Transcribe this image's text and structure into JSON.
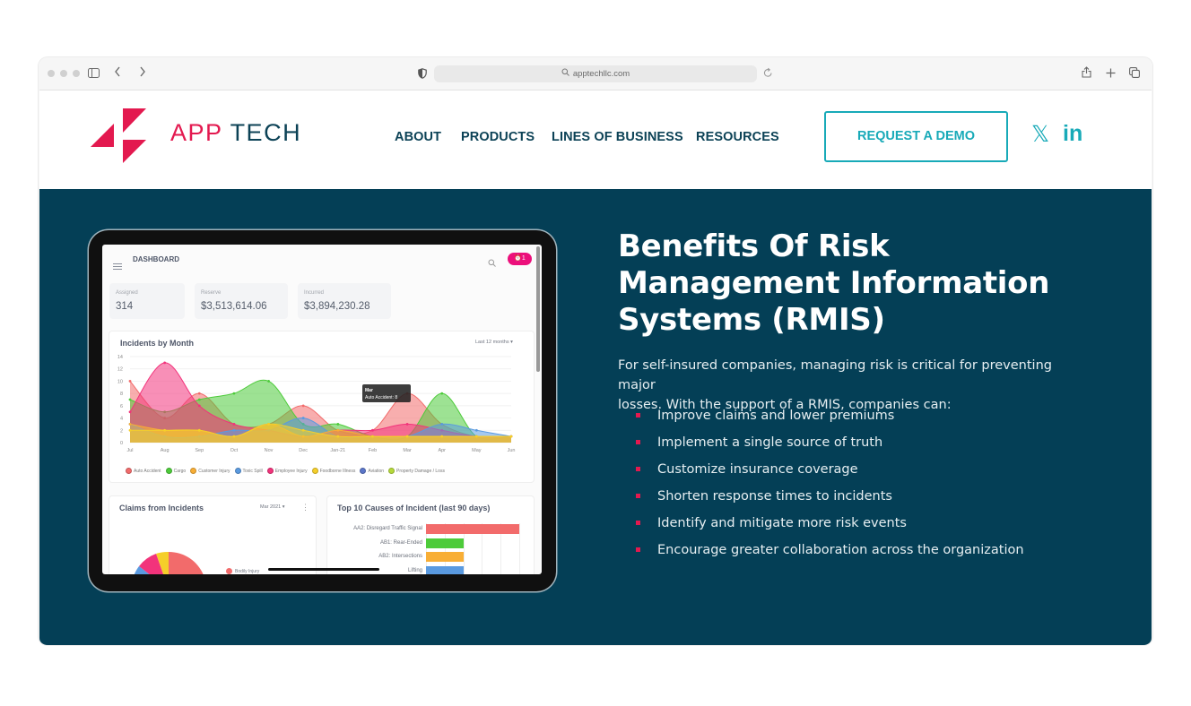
{
  "browser": {
    "url": "apptechllc.com",
    "icons": {
      "sidebar": "sidebar-icon",
      "back": "chevron-left-icon",
      "forward": "chevron-right-icon",
      "shield": "privacy-shield-icon",
      "reload": "reload-icon",
      "share": "share-icon",
      "new_tab": "plus-icon",
      "tabs": "tab-overview-icon"
    }
  },
  "header": {
    "brand_part1": "APP",
    "brand_part2": "TECH",
    "nav": [
      "ABOUT",
      "PRODUCTS",
      "LINES OF BUSINESS",
      "RESOURCES"
    ],
    "cta": "REQUEST A DEMO",
    "social": {
      "x": "𝕏",
      "linkedin": "in"
    },
    "colors": {
      "brand_red": "#e3194f",
      "brand_navy": "#0c4256",
      "accent_teal": "#18aab8"
    }
  },
  "hero": {
    "background": "#043f56",
    "heading_lines": [
      "Benefits Of Risk",
      "Management Information",
      "Systems (RMIS)"
    ],
    "intro_lines": [
      "For self-insured companies, managing risk is critical for preventing major",
      "losses. With the support of a RMIS, companies can:"
    ],
    "benefits": [
      "Improve claims and lower premiums",
      "Implement a single source of truth",
      "Customize insurance coverage",
      "Shorten response times to incidents",
      "Identify and mitigate more risk events",
      "Encourage greater collaboration across the organization"
    ]
  },
  "dashboard": {
    "title": "DASHBOARD",
    "notification_count": "1",
    "stats": [
      {
        "label": "Assigned",
        "value": "314"
      },
      {
        "label": "Reserve",
        "value": "$3,513,614.06"
      },
      {
        "label": "Incurred",
        "value": "$3,894,230.28"
      }
    ],
    "incidents_card": {
      "title": "Incidents by Month",
      "range_selector": "Last 12 months",
      "tooltip": {
        "title": "Mar",
        "text": "Auto Accident: 8"
      }
    },
    "claims_card": {
      "title": "Claims from Incidents",
      "period_selector": "Mar 2021",
      "legend_first": "Bodily Injury"
    },
    "causes_card": {
      "title": "Top 10 Causes of Incident (last 90 days)",
      "bars": [
        {
          "label": "AA2: Disregard Traffic Signal",
          "value": 5,
          "color": "#f26b6b"
        },
        {
          "label": "AB1: Rear-Ended",
          "value": 2,
          "color": "#4dcb3a"
        },
        {
          "label": "AB2: Intersections",
          "value": 2,
          "color": "#f8ae35"
        },
        {
          "label": "Lifting",
          "value": 2,
          "color": "#5a9ae0"
        }
      ]
    }
  },
  "chart_data": {
    "type": "area",
    "title": "Incidents by Month",
    "x": [
      "Jul",
      "Aug",
      "Sep",
      "Oct",
      "Nov",
      "Dec",
      "Jan-21",
      "Feb",
      "Mar",
      "Apr",
      "May",
      "Jun"
    ],
    "ylim": [
      0,
      14
    ],
    "yticks": [
      0,
      2,
      4,
      6,
      8,
      10,
      12,
      14
    ],
    "grid": true,
    "legend_position": "bottom",
    "series": [
      {
        "name": "Auto Accident",
        "color": "#f26b6b",
        "values": [
          10,
          4,
          8,
          3,
          3,
          6,
          2,
          2,
          8,
          3,
          1,
          1
        ]
      },
      {
        "name": "Cargo",
        "color": "#4dcb3a",
        "values": [
          7,
          5,
          7,
          8,
          10,
          3,
          3,
          1,
          1,
          8,
          1,
          1
        ]
      },
      {
        "name": "Customer Injury",
        "color": "#f8ae35",
        "values": [
          3,
          2,
          2,
          1,
          3,
          1,
          2,
          1,
          1,
          1,
          1,
          1
        ]
      },
      {
        "name": "Toxic Spill",
        "color": "#5a9ae0",
        "values": [
          3,
          1,
          1,
          2,
          2,
          4,
          1,
          1,
          1,
          3,
          2,
          1
        ]
      },
      {
        "name": "Employee Injury",
        "color": "#f2337b",
        "values": [
          5,
          13,
          6,
          3,
          2,
          1,
          2,
          2,
          3,
          2,
          1,
          1
        ]
      },
      {
        "name": "Foodborne Illness",
        "color": "#f5cf2a",
        "values": [
          2,
          2,
          2,
          1,
          3,
          2,
          1,
          1,
          1,
          1,
          1,
          1
        ]
      },
      {
        "name": "Aviation",
        "color": "#5b76c9",
        "values": []
      },
      {
        "name": "Property Damage / Loss",
        "color": "#b5d93a",
        "values": []
      }
    ]
  },
  "pie_data": {
    "type": "pie",
    "title": "Claims from Incidents",
    "visible_slices": [
      {
        "name": "Bodily Injury",
        "color": "#f26b6b"
      },
      {
        "name": "",
        "color": "#f5cf2a"
      },
      {
        "name": "",
        "color": "#f2337b"
      },
      {
        "name": "",
        "color": "#5a9ae0"
      }
    ]
  }
}
